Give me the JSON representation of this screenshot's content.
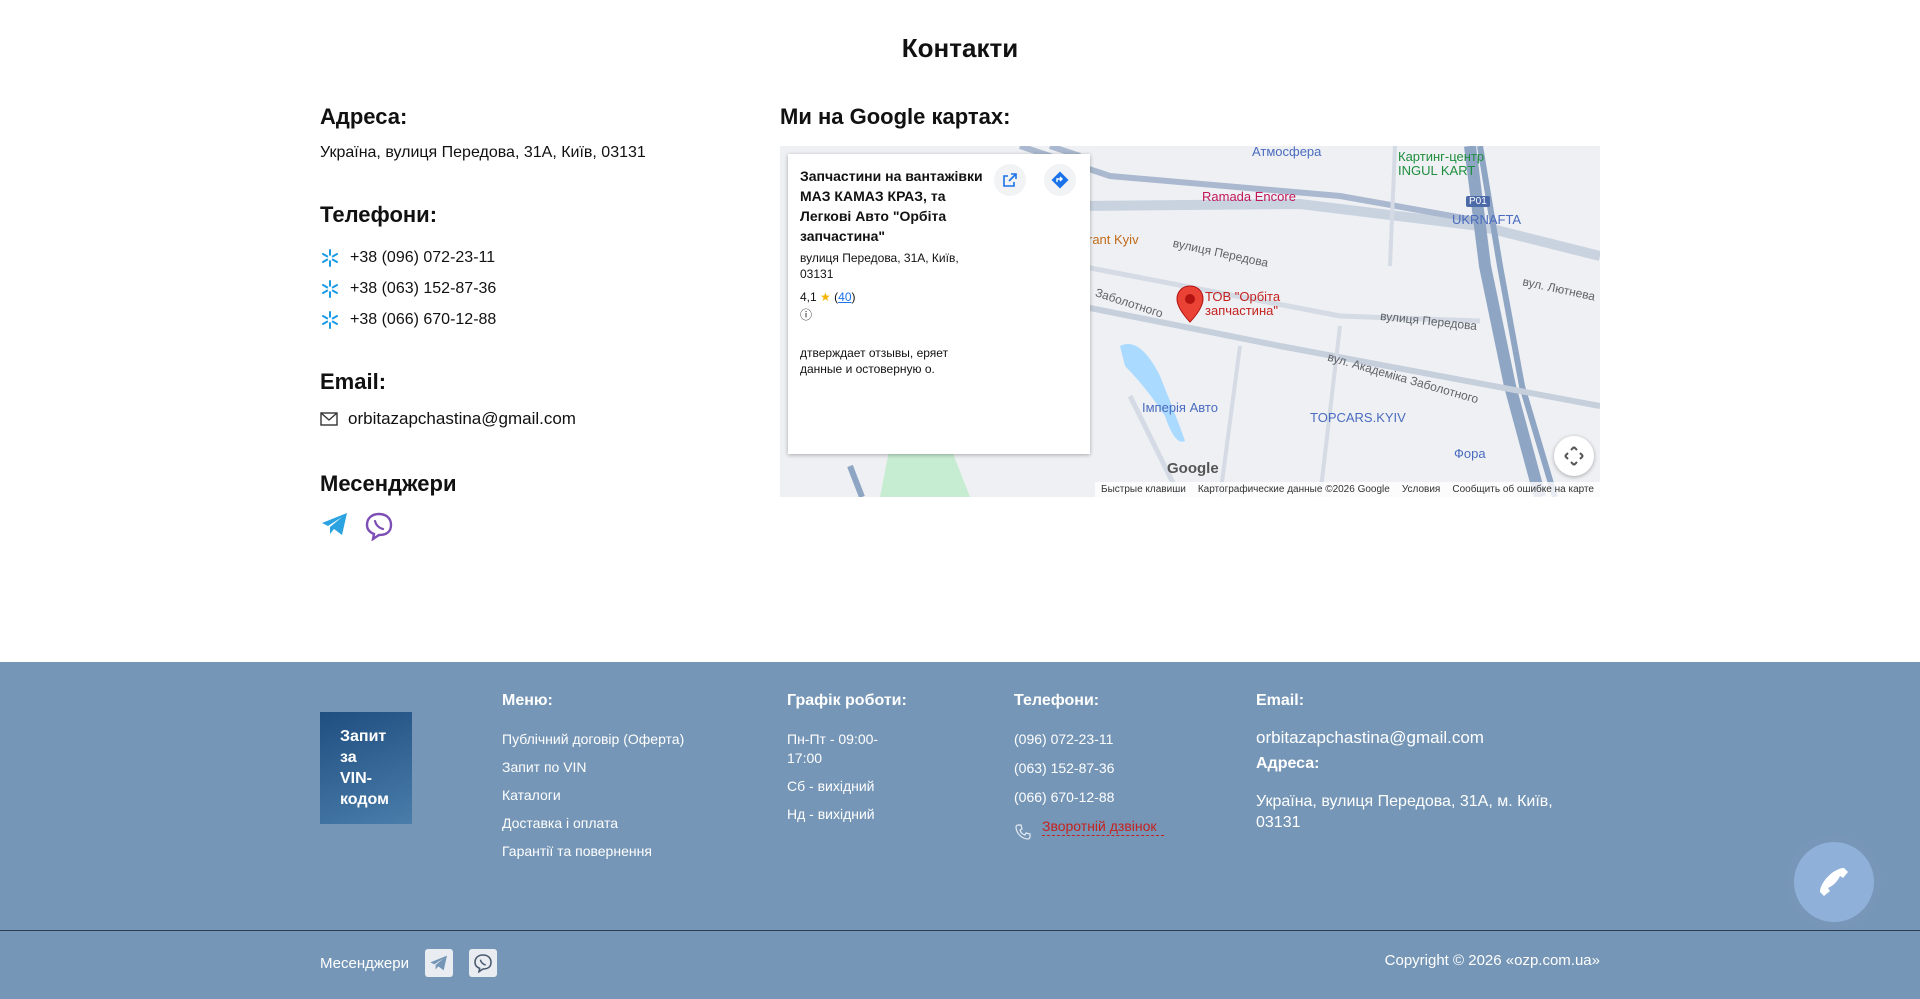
{
  "title": "Контакти",
  "contacts": {
    "address_heading": "Адреса:",
    "address": "Україна, вулиця Передова, 31А, Київ, 03131",
    "phones_heading": "Телефони:",
    "phones": [
      "+38 (096) 072-23-11",
      "+38 (063) 152-87-36",
      "+38 (066) 670-12-88"
    ],
    "email_heading": "Email:",
    "email": "orbitazapchastina@gmail.com",
    "messengers_heading": "Месенджери"
  },
  "map": {
    "heading": "Ми на Google картах:",
    "card": {
      "name": "Запчастини на вантажівки МАЗ КАМАЗ КРАЗ, та Легкові Авто \"Орбіта запчастина\"",
      "address": "вулиця Передова, 31А, Київ, 03131",
      "rating": "4,1",
      "reviews": "40",
      "review_note": "дтверждает отзывы, еряет данные и остоверную о."
    },
    "labels": {
      "atmosfera": "Атмосфера",
      "karting": "Картинг-центр INGUL KART",
      "ramada": "Ramada Encore",
      "ukrnafta": "UKRNAFTA",
      "restaurant": "rant Kyiv",
      "peredova1": "вулиця Передова",
      "zabolotnogo": "Заболотного",
      "peredova2": "вулиця Передова",
      "marker": "ТОВ \"Орбіта запчастина\"",
      "akademika": "вул. Академіка Заболотного",
      "lyutneva": "вул. Лютнева",
      "imperia": "Імперія Авто",
      "topcars": "TOPCARS.KYIV",
      "fora": "Фора",
      "p01": "P01"
    },
    "google": "Google",
    "attribution": [
      "Быстрые клавиши",
      "Картографические данные ©2026 Google",
      "Условия",
      "Сообщить об ошибке на карте"
    ]
  },
  "footer": {
    "vin_button": "Запит за VIN-кодом",
    "menu_heading": "Меню:",
    "menu": [
      "Публічний договір (Оферта)",
      "Запит по VIN",
      "Каталоги",
      "Доставка і оплата",
      "Гарантії та повернення"
    ],
    "schedule_heading": "Графік роботи:",
    "schedule": [
      "Пн-Пт - 09:00-17:00",
      "Сб - вихідний",
      "Нд - вихідний"
    ],
    "phones_heading": "Телефони:",
    "phones": [
      "(096) 072-23-11",
      "(063) 152-87-36",
      "(066) 670-12-88"
    ],
    "callback": "Зворотній дзвінок",
    "email_heading": "Email:",
    "email": "orbitazapchastina@gmail.com",
    "address_heading": "Адреса:",
    "address": "Україна, вулиця Передова, 31А, м. Київ, 03131",
    "messengers_label": "Месенджери",
    "copyright": "Copyright © 2026 «ozp.com.ua»"
  }
}
